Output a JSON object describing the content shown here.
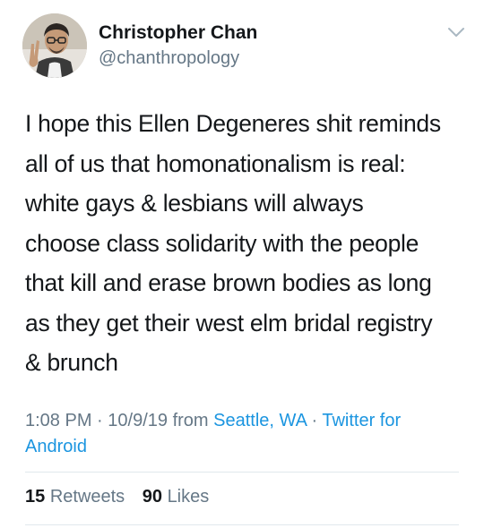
{
  "author": {
    "name": "Christopher Chan",
    "handle": "@chanthropology"
  },
  "tweet": {
    "text": "I hope this Ellen Degeneres shit reminds\nall of us that homonationalism is real:\nwhite gays & lesbians will always\nchoose class solidarity with the people\nthat kill and erase brown bodies as long\nas they get their west elm bridal registry\n& brunch"
  },
  "meta": {
    "time": "1:08 PM",
    "date": "10/9/19",
    "from_label": "from",
    "location": "Seattle, WA",
    "separator": "·",
    "client": "Twitter for Android"
  },
  "stats": {
    "retweets_count": "15",
    "retweets_label": "Retweets",
    "likes_count": "90",
    "likes_label": "Likes"
  },
  "icons": {
    "caret": "chevron-down-icon",
    "avatar": "user-avatar-photo"
  },
  "colors": {
    "text": "#14171a",
    "secondary": "#657786",
    "link": "#1b95e0",
    "divider": "#e1e8ed"
  }
}
